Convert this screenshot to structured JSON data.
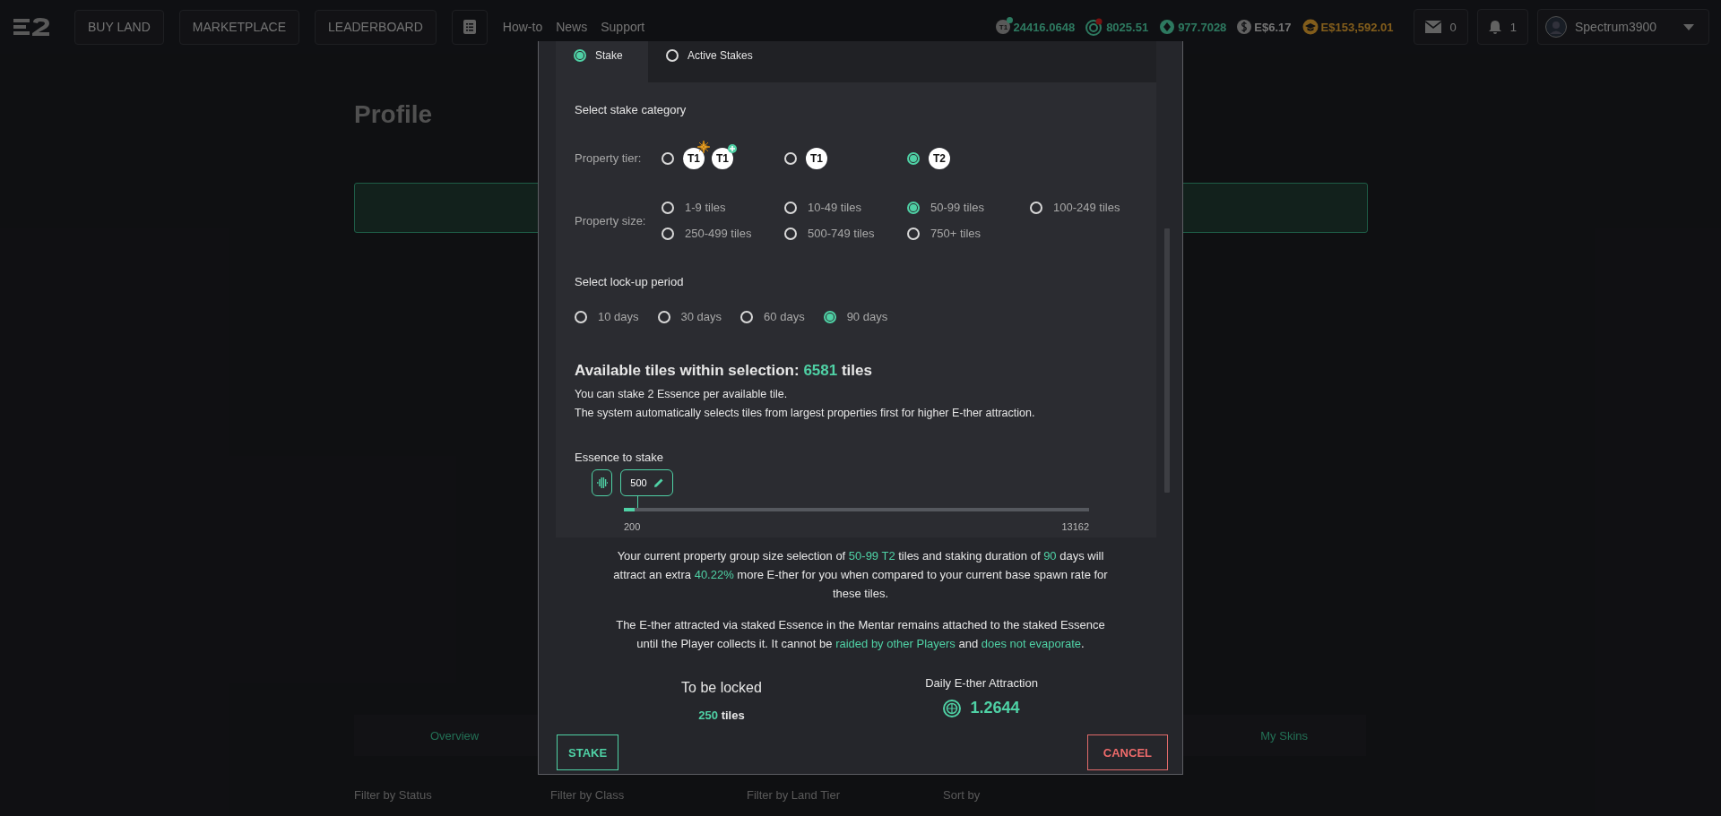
{
  "header": {
    "nav_buttons": [
      "BUY LAND",
      "MARKETPLACE",
      "LEADERBOARD"
    ],
    "links": [
      "How-to",
      "News",
      "Support"
    ],
    "balances": [
      {
        "kind": "tier",
        "badge": "T1",
        "value": "24416.0648"
      },
      {
        "kind": "target",
        "value": "8025.51"
      },
      {
        "kind": "gem",
        "value": "977.7028"
      },
      {
        "kind": "dollar",
        "value": "E$6.17"
      },
      {
        "kind": "cap",
        "value": "E$153,592.01"
      }
    ],
    "mail_count": "0",
    "notification_count": "1",
    "username": "Spectrum3900"
  },
  "background": {
    "title": "Profile",
    "tabs": [
      "Overview",
      "My Skins"
    ],
    "filters": [
      "Filter by Status",
      "Filter by Class",
      "Filter by Land Tier",
      "Sort by"
    ]
  },
  "modal": {
    "tabs": [
      {
        "label": "Stake",
        "selected": true
      },
      {
        "label": "Active Stakes",
        "selected": false
      }
    ],
    "category_heading": "Select stake category",
    "property_tier": {
      "label": "Property tier:",
      "options": [
        {
          "selected": false,
          "badges": [
            {
              "text": "T1",
              "kind": "emblem"
            },
            {
              "text": "T1",
              "kind": "plus"
            }
          ]
        },
        {
          "selected": false,
          "badges": [
            {
              "text": "T1",
              "kind": "plain"
            }
          ]
        },
        {
          "selected": true,
          "badges": [
            {
              "text": "T2",
              "kind": "plain"
            }
          ]
        }
      ]
    },
    "property_size": {
      "label": "Property size:",
      "options": [
        {
          "label": "1-9 tiles",
          "selected": false
        },
        {
          "label": "10-49 tiles",
          "selected": false
        },
        {
          "label": "50-99 tiles",
          "selected": true
        },
        {
          "label": "100-249 tiles",
          "selected": false
        },
        {
          "label": "250-499 tiles",
          "selected": false
        },
        {
          "label": "500-749 tiles",
          "selected": false
        },
        {
          "label": "750+ tiles",
          "selected": false
        }
      ]
    },
    "lockup_heading": "Select lock-up period",
    "lockup_options": [
      {
        "label": "10 days",
        "selected": false
      },
      {
        "label": "30 days",
        "selected": false
      },
      {
        "label": "60 days",
        "selected": false
      },
      {
        "label": "90 days",
        "selected": true
      }
    ],
    "available": {
      "label": "Available tiles within selection:",
      "count": "6581",
      "unit": "tiles"
    },
    "notes": [
      "You can stake 2 Essence per available tile.",
      "The system automatically selects tiles from largest properties first for higher E-ther attraction."
    ],
    "essence": {
      "label": "Essence to stake",
      "value": "500",
      "min": "200",
      "max": "13162",
      "level": 0.023
    },
    "paragraphs": [
      [
        {
          "text": "Your current property group size selection of ",
          "highlight": false
        },
        {
          "text": "50-99 T2",
          "highlight": true
        },
        {
          "text": " tiles and staking duration of ",
          "highlight": false
        },
        {
          "text": "90",
          "highlight": true
        },
        {
          "text": " days will attract an extra ",
          "highlight": false
        },
        {
          "text": "40.22%",
          "highlight": true
        },
        {
          "text": " more E-ther for you when compared to your current base spawn rate for these tiles.",
          "highlight": false
        }
      ],
      [
        {
          "text": "The E-ther attracted via staked Essence in the Mentar remains attached to the staked Essence until the Player collects it. It cannot be ",
          "highlight": false
        },
        {
          "text": "raided by other Players",
          "highlight": true
        },
        {
          "text": " and ",
          "highlight": false
        },
        {
          "text": "does not evaporate",
          "highlight": true
        },
        {
          "text": ".",
          "highlight": false
        }
      ]
    ],
    "to_be_locked": {
      "label": "To be locked",
      "value": "250",
      "unit": "tiles"
    },
    "daily": {
      "label": "Daily E-ther Attraction",
      "value": "1.2644"
    },
    "buttons": {
      "confirm": "STAKE",
      "cancel": "CANCEL"
    }
  }
}
